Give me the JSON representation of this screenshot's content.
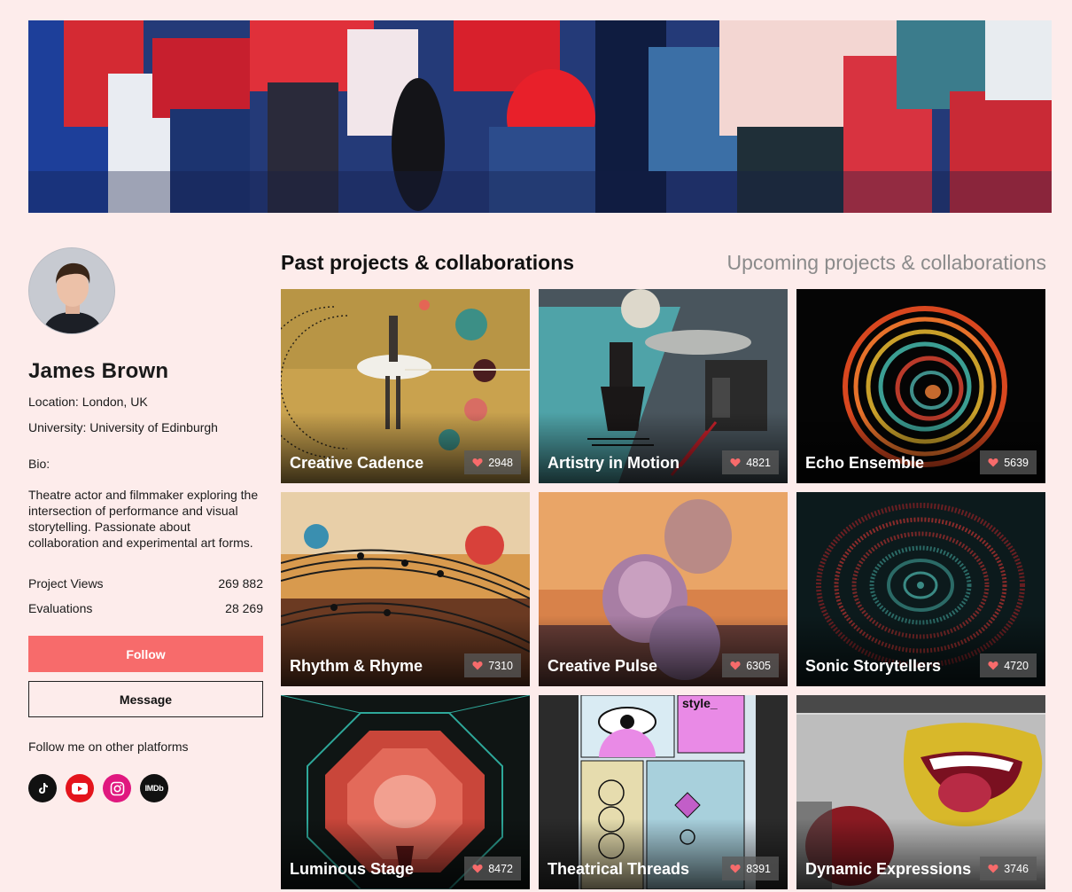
{
  "profile": {
    "name": "James Brown",
    "location": "Location: London, UK",
    "university": "University: University of Edinburgh",
    "bio_label": "Bio:",
    "bio": "Theatre actor and filmmaker exploring the intersection of performance and visual storytelling. Passionate about collaboration and experimental art forms.",
    "stats": [
      {
        "label": "Project Views",
        "value": "269 882"
      },
      {
        "label": "Evaluations",
        "value": "28 269"
      }
    ],
    "follow_label": "Follow",
    "message_label": "Message",
    "platforms_label": "Follow me on other platforms",
    "socials": [
      {
        "icon": "tiktok-icon"
      },
      {
        "icon": "youtube-icon"
      },
      {
        "icon": "instagram-icon"
      },
      {
        "icon": "imdb-icon",
        "text": "IMDb"
      }
    ]
  },
  "tabs": {
    "past": "Past projects & collaborations",
    "upcoming": "Upcoming projects & collaborations"
  },
  "projects": [
    {
      "title": "Creative Cadence",
      "likes": "2948"
    },
    {
      "title": "Artistry in Motion",
      "likes": "4821"
    },
    {
      "title": "Echo Ensemble",
      "likes": "5639"
    },
    {
      "title": "Rhythm & Rhyme",
      "likes": "7310"
    },
    {
      "title": "Creative Pulse",
      "likes": "6305"
    },
    {
      "title": "Sonic Storytellers",
      "likes": "4720"
    },
    {
      "title": "Luminous Stage",
      "likes": "8472"
    },
    {
      "title": "Theatrical Threads",
      "likes": "8391"
    },
    {
      "title": "Dynamic Expressions",
      "likes": "3746"
    }
  ],
  "colors": {
    "background": "#fdeceb",
    "accent": "#f76b6b",
    "like": "#f76b6b"
  }
}
